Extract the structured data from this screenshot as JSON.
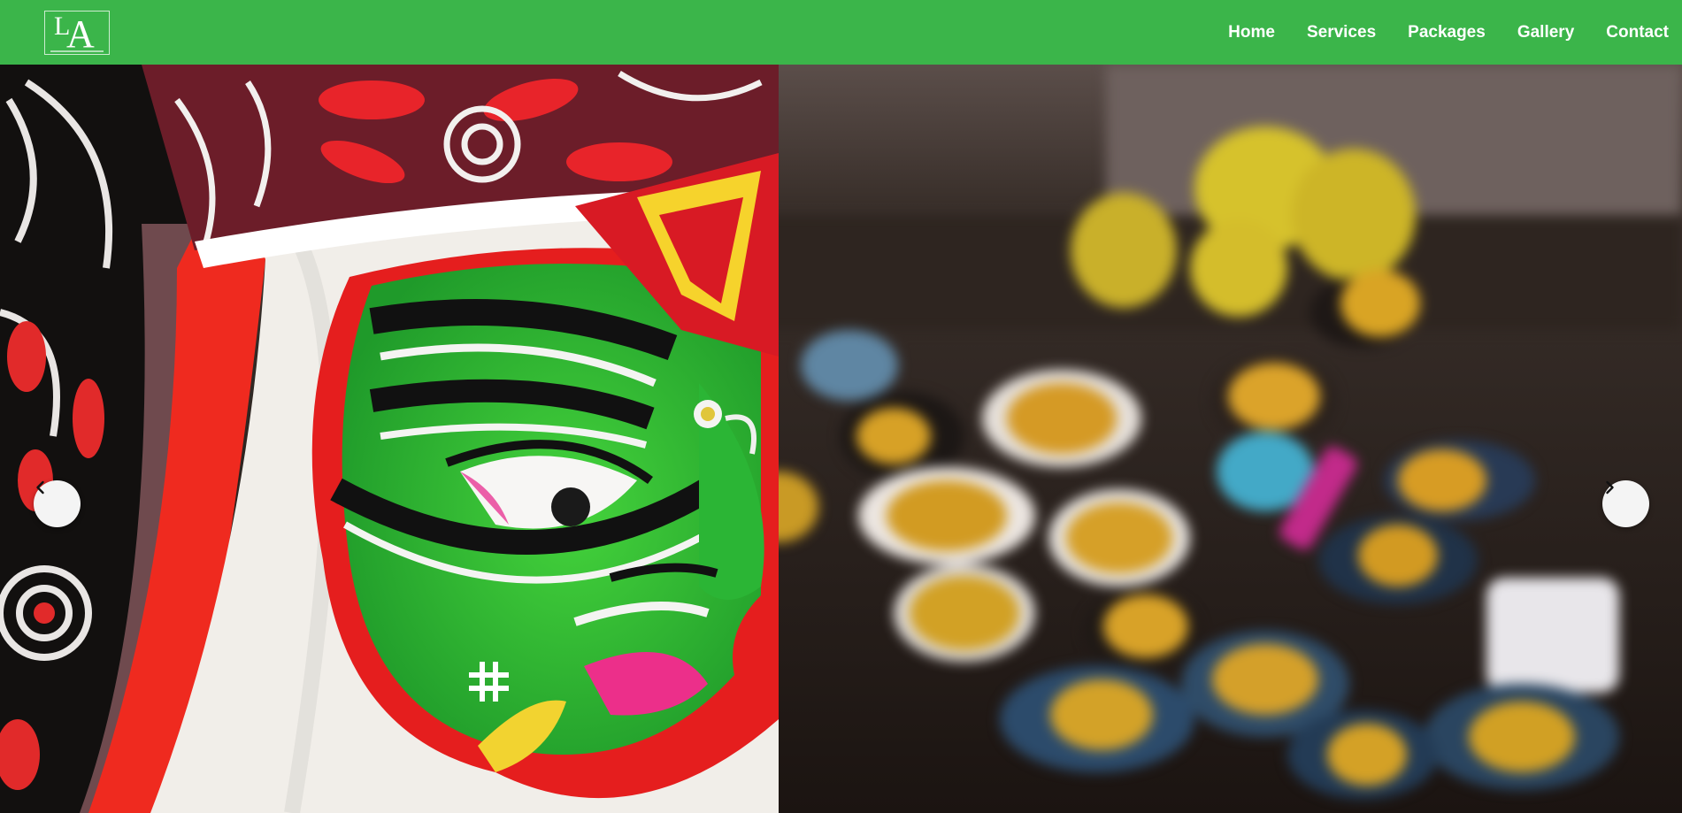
{
  "brand": {
    "logo_text_l": "L",
    "logo_text_a": "A"
  },
  "nav": {
    "items": [
      {
        "label": "Home"
      },
      {
        "label": "Services"
      },
      {
        "label": "Packages"
      },
      {
        "label": "Gallery"
      },
      {
        "label": "Contact"
      }
    ]
  },
  "carousel": {
    "slide_count": 6,
    "active_index": 0,
    "prev_icon": "chevron-left-icon",
    "next_icon": "chevron-right-icon"
  },
  "colors": {
    "nav_bg": "#3bb54a",
    "mask_green": "#35c43a",
    "mask_red": "#e01d1d",
    "mask_white": "#f1eee9"
  }
}
